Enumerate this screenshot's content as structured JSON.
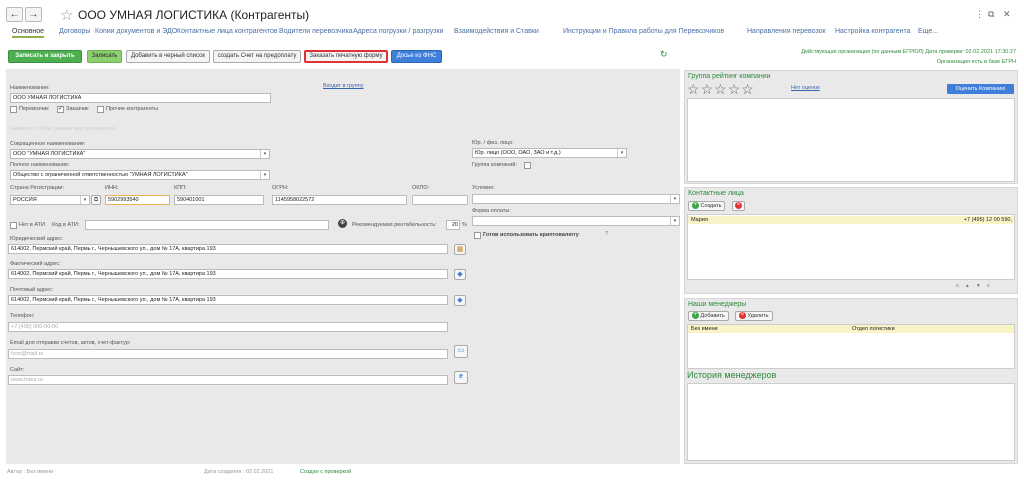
{
  "window": {
    "title": "ООО УМНАЯ ЛОГИСТИКА (Контрагенты)",
    "back_glyph": "←",
    "forward_glyph": "→",
    "window_controls": [
      "⋮",
      "⧉",
      "✕"
    ]
  },
  "tabs": [
    {
      "label": "Основное",
      "active": true
    },
    {
      "label": "Договоры"
    },
    {
      "label": "Копии документов и ЭДО"
    },
    {
      "label": "Контактные лица контрагентов"
    },
    {
      "label": "Водители перевозчика"
    },
    {
      "label": "Адреса погрузки / разгрузки"
    },
    {
      "label": "Взаимодействия и Ставки"
    },
    {
      "label": "Инструкции и Правила работы для Перевозчиков"
    },
    {
      "label": "Направления перевозок"
    },
    {
      "label": "Настройка контрагента"
    },
    {
      "label": "Еще..."
    }
  ],
  "toolbar": {
    "save_close": "Записать и закрыть",
    "save": "Записать",
    "blacklist": "Добавить в черный список",
    "prepay_invoice": "создать Счет на предоплату",
    "order_print": "Заказать печатную форму",
    "fns_dossier": "Досье из ФНС",
    "refresh_glyph": "↻"
  },
  "status": {
    "line1": "Действующая организация (по данным ЕГРЮЛ) Дата проверки: 02.02.2021 17:30:27",
    "line2": "Организация есть в базе ЕГРН"
  },
  "form": {
    "name_label": "Наименование:",
    "name_value": "ООО УМНАЯ ЛОГИСТИКА",
    "group_link": "Входит в группу",
    "cb_carrier": "Перевозчик",
    "cb_customer": "Заказчик",
    "cb_other": "Прочие контрагенты",
    "faded_hint": "Нажмите, чтобы указать вид контрагента",
    "short_name_label": "Сокращенное наименование:",
    "short_name_value": "ООО \"УМНАЯ ЛОГИСТИКА\"",
    "full_name_label": "Полное наименование:",
    "full_name_value": "Общество с ограниченной ответственностью \"УМНАЯ ЛОГИСТИКА\"",
    "legal_type_label": "Юр. / физ. лицо:",
    "legal_type_value": "Юр. лицо (ООО, ОАО, ЗАО и т.д.)",
    "company_group_label": "Группа компаний:",
    "country_label": "Страна Регистрации:",
    "country_value": "РОССИЯ",
    "inn_label": "ИНН:",
    "inn_value": "5902993540",
    "kpp_label": "КПП:",
    "kpp_value": "590401001",
    "ogrn_label": "ОГРН:",
    "ogrn_value": "1145958022572",
    "okpo_label": "ОКПО:",
    "okpo_value": "",
    "condition_label": "Условие:",
    "ati_label": "Нет в АТИ",
    "ati_code_label": "Код в АТИ:",
    "profit_label": "Рекомендуемая рентабельность:",
    "profit_value": "20",
    "profit_unit": "%",
    "payment_label": "Форма оплаты:",
    "crypto_label": "Готов использовать криптовалюту",
    "crypto_help": "?",
    "legal_addr_label": "Юридический адрес:",
    "legal_addr_value": "614002, Пермский край, Пермь г., Чернышевского ул., дом № 17А, квартира 193",
    "fact_addr_label": "Фактический адрес:",
    "fact_addr_value": "614002, Пермский край, Пермь г., Чернышевского ул., дом № 17А, квартира 193",
    "post_addr_label": "Почтовый адрес:",
    "post_addr_value": "614002, Пермский край, Пермь г., Чернышевского ул., дом № 17А, квартира 193",
    "phone_label": "Телефон:",
    "phone_placeholder": "+7 (495) 000-00-00",
    "email_label": "Email для отправки счетов, актов, счет-фактур:",
    "email_placeholder": "fyon@mail.ru",
    "site_label": "Сайт:",
    "site_placeholder": "www.trans.ru"
  },
  "rating": {
    "title": "Группа рейтинг компании",
    "stars": [
      "☆",
      "☆",
      "☆",
      "☆",
      "☆"
    ],
    "no_ratings": "Нет оценок",
    "rate_button": "Оценить Компанию"
  },
  "contacts": {
    "title": "Контактные лица",
    "create": "Создать",
    "rows": [
      {
        "name": "Мария",
        "phone": "+7 (495) 12 00 590,"
      }
    ],
    "nav": [
      "≡",
      "▲",
      "▼",
      "≡"
    ]
  },
  "managers": {
    "title": "Наши менеджеры",
    "add": "Добавить",
    "delete": "Удалить",
    "columns": [
      "Без имени",
      "Отдел логистики"
    ]
  },
  "history": {
    "title": "История менеджеров"
  },
  "footer": {
    "author": "Автор : Без имени",
    "created": "Дата создания : 02.02.2021",
    "checked": "Создан с проверкой"
  },
  "colors": {
    "accent_green": "#2e8b3d",
    "link_blue": "#3a65b0",
    "highlight_red": "#dd3333"
  }
}
